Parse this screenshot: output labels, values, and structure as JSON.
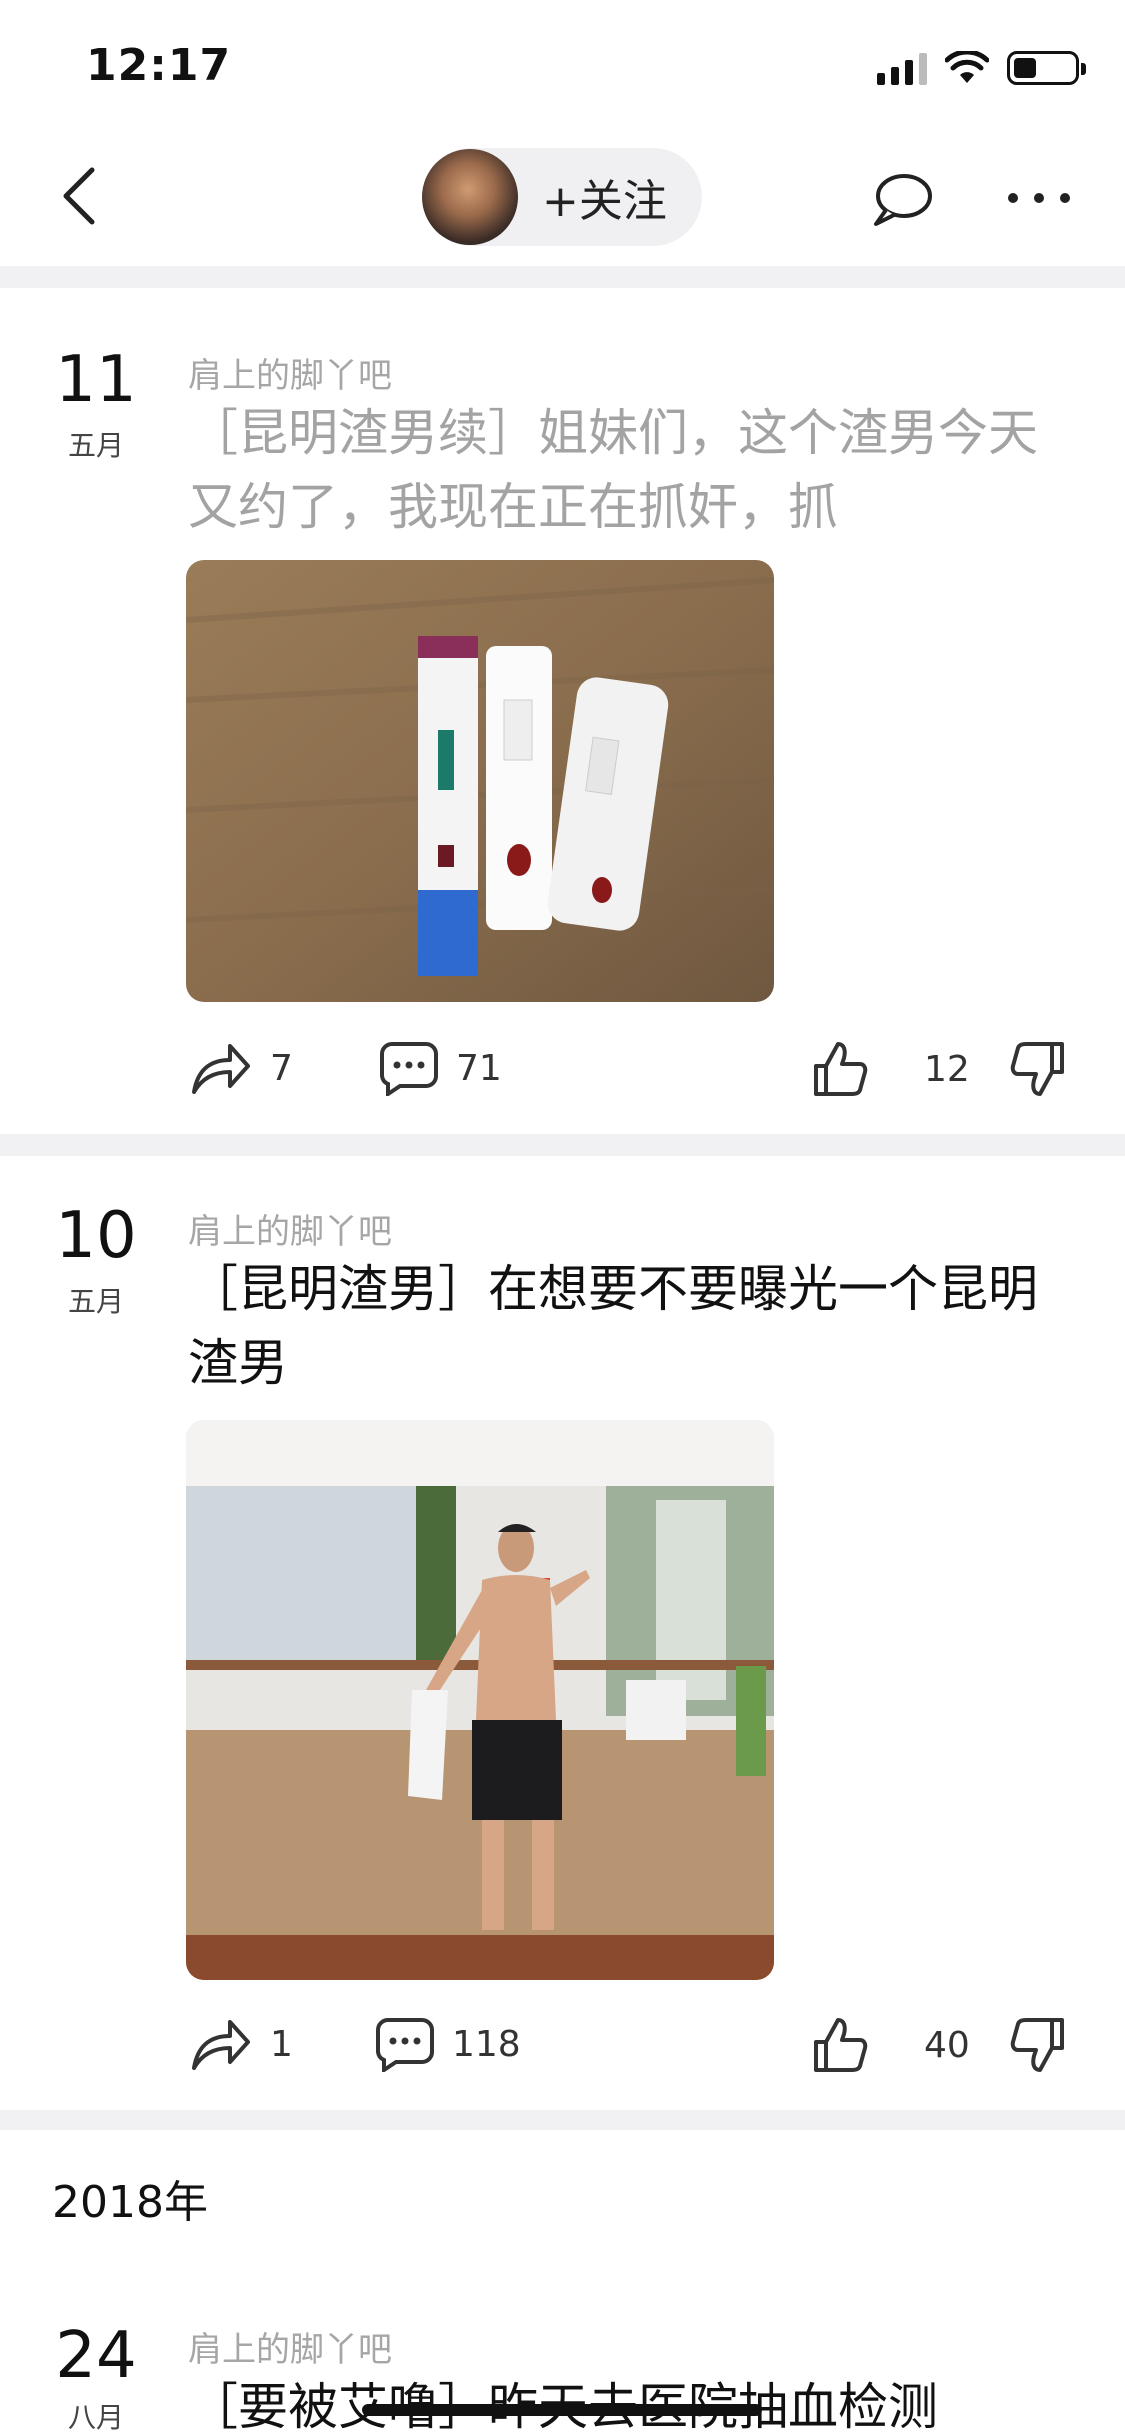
{
  "status_bar": {
    "time": "12:17"
  },
  "nav": {
    "follow_label": "+关注"
  },
  "posts": [
    {
      "day": "11",
      "month": "五月",
      "forum": "肩上的脚丫吧",
      "title": "［昆明渣男续］姐妹们，这个渣男今天又约了，我现在正在抓奸，抓",
      "image_desc_icon": "pregnancy-test-photo",
      "shares": "7",
      "comments": "71",
      "likes": "12"
    },
    {
      "day": "10",
      "month": "五月",
      "forum": "肩上的脚丫吧",
      "title": "［昆明渣男］在想要不要曝光一个昆明渣男",
      "image_desc_icon": "gym-selfie-photo",
      "shares": "1",
      "comments": "118",
      "likes": "40"
    },
    {
      "day": "24",
      "month": "八月",
      "forum": "肩上的脚丫吧",
      "title": "［要被艾噜］昨天去医院抽血检测"
    }
  ],
  "year_label": "2018年",
  "colors": {
    "divider": "#f1f1f3",
    "muted_text": "#a3a3a3"
  }
}
